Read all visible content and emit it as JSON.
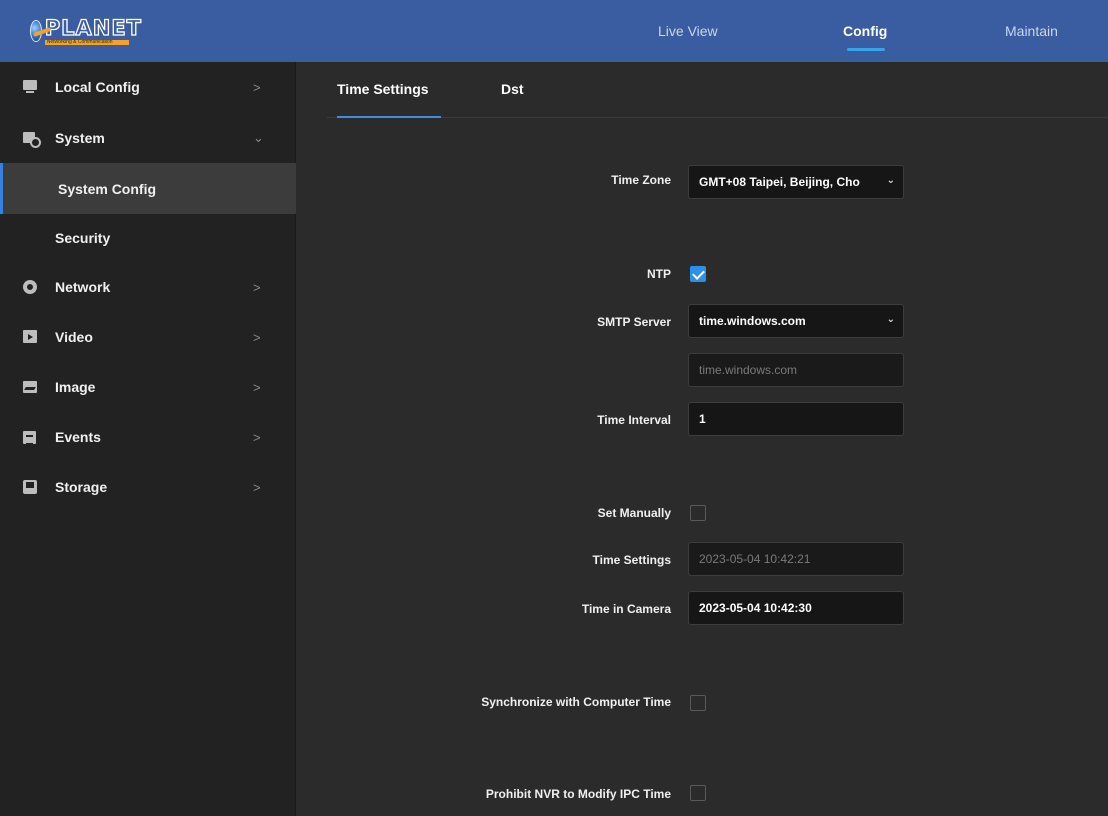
{
  "header": {
    "logo_text": "PLANET",
    "logo_subtext": "Networking & Communication",
    "nav": [
      "Live View",
      "Config",
      "Maintain"
    ],
    "active_nav": "Config"
  },
  "sidebar": {
    "items": [
      {
        "label": "Local Config",
        "icon": "monitor-icon",
        "chevron": ">"
      },
      {
        "label": "System",
        "icon": "system-icon",
        "chevron": "⌄"
      },
      {
        "label": "System Config"
      },
      {
        "label": "Security"
      },
      {
        "label": "Network",
        "icon": "network-icon",
        "chevron": ">"
      },
      {
        "label": "Video",
        "icon": "video-icon",
        "chevron": ">"
      },
      {
        "label": "Image",
        "icon": "image-icon",
        "chevron": ">"
      },
      {
        "label": "Events",
        "icon": "events-icon",
        "chevron": ">"
      },
      {
        "label": "Storage",
        "icon": "storage-icon",
        "chevron": ">"
      }
    ]
  },
  "tabs": [
    "Time Settings",
    "Dst"
  ],
  "form": {
    "time_zone_label": "Time Zone",
    "time_zone_value": "GMT+08 Taipei, Beijing, Cho",
    "ntp_label": "NTP",
    "ntp_checked": true,
    "smtp_label": "SMTP Server",
    "smtp_value": "time.windows.com",
    "smtp_custom_placeholder": "time.windows.com",
    "interval_label": "Time Interval",
    "interval_value": "1",
    "set_manually_label": "Set Manually",
    "set_manually_checked": false,
    "time_settings_label": "Time Settings",
    "time_settings_value": "2023-05-04 10:42:21",
    "time_camera_label": "Time in Camera",
    "time_camera_value": "2023-05-04 10:42:30",
    "sync_label": "Synchronize with Computer Time",
    "sync_checked": false,
    "prohibit_label": "Prohibit NVR to Modify IPC Time",
    "prohibit_checked": false
  },
  "colors": {
    "header_bg": "#3a5ca0",
    "accent": "#2f8fe6",
    "sidebar_bg": "#222222",
    "main_bg": "#2b2b2b"
  }
}
